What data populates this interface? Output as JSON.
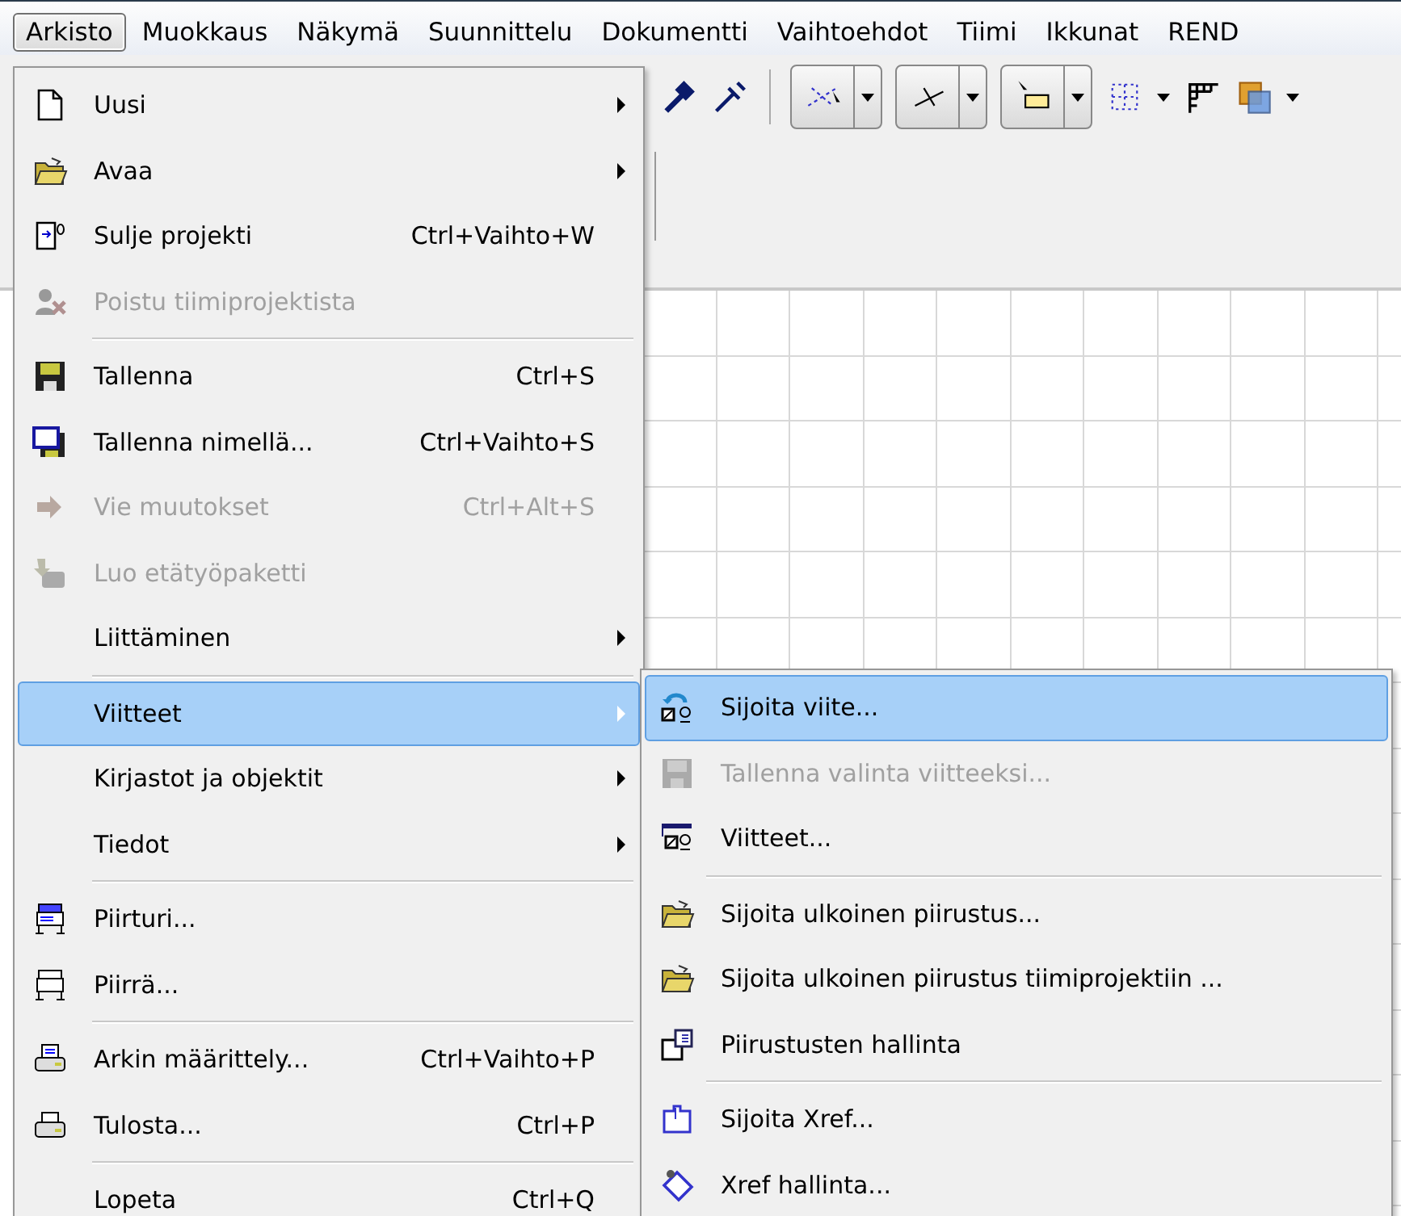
{
  "menu_bar": [
    {
      "label": "Arkisto",
      "selected": true
    },
    {
      "label": "Muokkaus",
      "selected": false
    },
    {
      "label": "Näkymä",
      "selected": false
    },
    {
      "label": "Suunnittelu",
      "selected": false
    },
    {
      "label": "Dokumentti",
      "selected": false
    },
    {
      "label": "Vaihtoehdot",
      "selected": false
    },
    {
      "label": "Tiimi",
      "selected": false
    },
    {
      "label": "Ikkunat",
      "selected": false
    },
    {
      "label": "REND",
      "selected": false
    }
  ],
  "file_menu": {
    "items": [
      {
        "kind": "item",
        "label": "Uusi",
        "submenu": true,
        "disabled": false,
        "selected": false
      },
      {
        "kind": "item",
        "label": "Avaa",
        "submenu": true,
        "disabled": false,
        "selected": false
      },
      {
        "kind": "item",
        "label": "Sulje projekti",
        "shortcut": "Ctrl+Vaihto+W",
        "submenu": false,
        "disabled": false,
        "selected": false
      },
      {
        "kind": "item",
        "label": "Poistu tiimiprojektista",
        "submenu": false,
        "disabled": true,
        "selected": false
      },
      {
        "kind": "separator"
      },
      {
        "kind": "item",
        "label": "Tallenna",
        "shortcut": "Ctrl+S",
        "submenu": false,
        "disabled": false,
        "selected": false
      },
      {
        "kind": "item",
        "label": "Tallenna nimellä...",
        "shortcut": "Ctrl+Vaihto+S",
        "submenu": false,
        "disabled": false,
        "selected": false
      },
      {
        "kind": "item",
        "label": "Vie muutokset",
        "shortcut": "Ctrl+Alt+S",
        "submenu": false,
        "disabled": true,
        "selected": false
      },
      {
        "kind": "item",
        "label": "Luo etätyöpaketti",
        "submenu": false,
        "disabled": true,
        "selected": false
      },
      {
        "kind": "item",
        "label": "Liittäminen",
        "submenu": true,
        "disabled": false,
        "selected": false
      },
      {
        "kind": "separator"
      },
      {
        "kind": "item",
        "label": "Viitteet",
        "submenu": true,
        "disabled": false,
        "selected": true
      },
      {
        "kind": "item",
        "label": "Kirjastot ja objektit",
        "submenu": true,
        "disabled": false,
        "selected": false
      },
      {
        "kind": "item",
        "label": "Tiedot",
        "submenu": true,
        "disabled": false,
        "selected": false
      },
      {
        "kind": "separator"
      },
      {
        "kind": "item",
        "label": "Piirturi...",
        "submenu": false,
        "disabled": false,
        "selected": false
      },
      {
        "kind": "item",
        "label": "Piirrä...",
        "submenu": false,
        "disabled": false,
        "selected": false
      },
      {
        "kind": "separator"
      },
      {
        "kind": "item",
        "label": "Arkin määrittely...",
        "shortcut": "Ctrl+Vaihto+P",
        "submenu": false,
        "disabled": false,
        "selected": false
      },
      {
        "kind": "item",
        "label": "Tulosta...",
        "shortcut": "Ctrl+P",
        "submenu": false,
        "disabled": false,
        "selected": false
      },
      {
        "kind": "separator"
      },
      {
        "kind": "item",
        "label": "Lopeta",
        "shortcut": "Ctrl+Q",
        "submenu": false,
        "disabled": false,
        "selected": false
      }
    ]
  },
  "references_submenu": {
    "items": [
      {
        "kind": "item",
        "label": "Sijoita viite...",
        "disabled": false,
        "selected": true
      },
      {
        "kind": "item",
        "label": "Tallenna valinta viitteeksi...",
        "disabled": true,
        "selected": false
      },
      {
        "kind": "item",
        "label": "Viitteet...",
        "disabled": false,
        "selected": false
      },
      {
        "kind": "separator"
      },
      {
        "kind": "item",
        "label": "Sijoita ulkoinen piirustus...",
        "disabled": false,
        "selected": false
      },
      {
        "kind": "item",
        "label": "Sijoita ulkoinen piirustus tiimiprojektiin ...",
        "disabled": false,
        "selected": false
      },
      {
        "kind": "item",
        "label": "Piirustusten hallinta",
        "disabled": false,
        "selected": false
      },
      {
        "kind": "separator"
      },
      {
        "kind": "item",
        "label": "Sijoita Xref...",
        "disabled": false,
        "selected": false
      },
      {
        "kind": "item",
        "label": "Xref hallinta...",
        "disabled": false,
        "selected": false
      }
    ]
  }
}
